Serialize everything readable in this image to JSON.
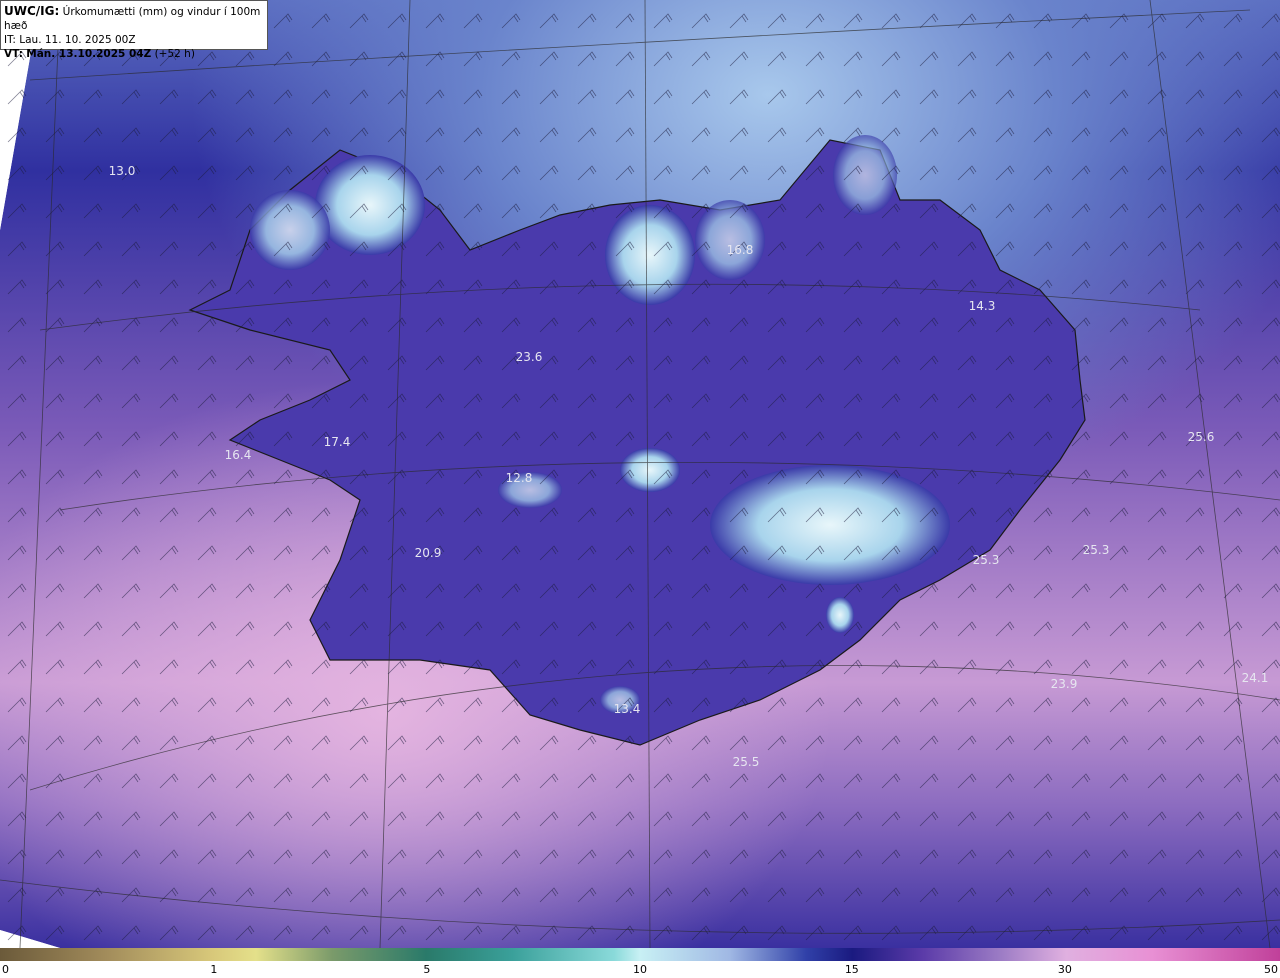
{
  "header": {
    "code": "UWC/IG:",
    "title": "Úrkomumætti (mm) og vindur í 100m hæð",
    "init_label": "IT:",
    "init_time": "Lau. 11. 10. 2025 00Z",
    "valid_label": "VT:",
    "valid_time": "Mán. 13.10.2025 04Z",
    "lead_time": "(+52 h)"
  },
  "colors": {
    "sea_low": "#2c2c8c",
    "sea_mid": "#4a4aa8",
    "sea_high": "#9c7cc4",
    "pink": "#d8a8dc",
    "north_light": "#7fa0d8",
    "land_dark": "#3a3aa0",
    "land_light": "#c8e8f4",
    "coast": "#222222"
  },
  "colorbar": {
    "ticks": [
      {
        "label": "0",
        "pos": 0
      },
      {
        "label": "1",
        "pos": 0.166
      },
      {
        "label": "5",
        "pos": 0.333
      },
      {
        "label": "10",
        "pos": 0.5
      },
      {
        "label": "15",
        "pos": 0.666
      },
      {
        "label": "30",
        "pos": 0.833
      },
      {
        "label": "50",
        "pos": 1
      }
    ]
  },
  "values": [
    {
      "label": "13.0"
    },
    {
      "label": "16.8"
    },
    {
      "label": "14.3"
    },
    {
      "label": "23.6"
    },
    {
      "label": "17.4"
    },
    {
      "label": "16.4"
    },
    {
      "label": "12.8"
    },
    {
      "label": "25.6"
    },
    {
      "label": "25.3"
    },
    {
      "label": "25.3"
    },
    {
      "label": "20.9"
    },
    {
      "label": "23.9"
    },
    {
      "label": "24.1"
    },
    {
      "label": "13.4"
    },
    {
      "label": "25.5"
    }
  ]
}
